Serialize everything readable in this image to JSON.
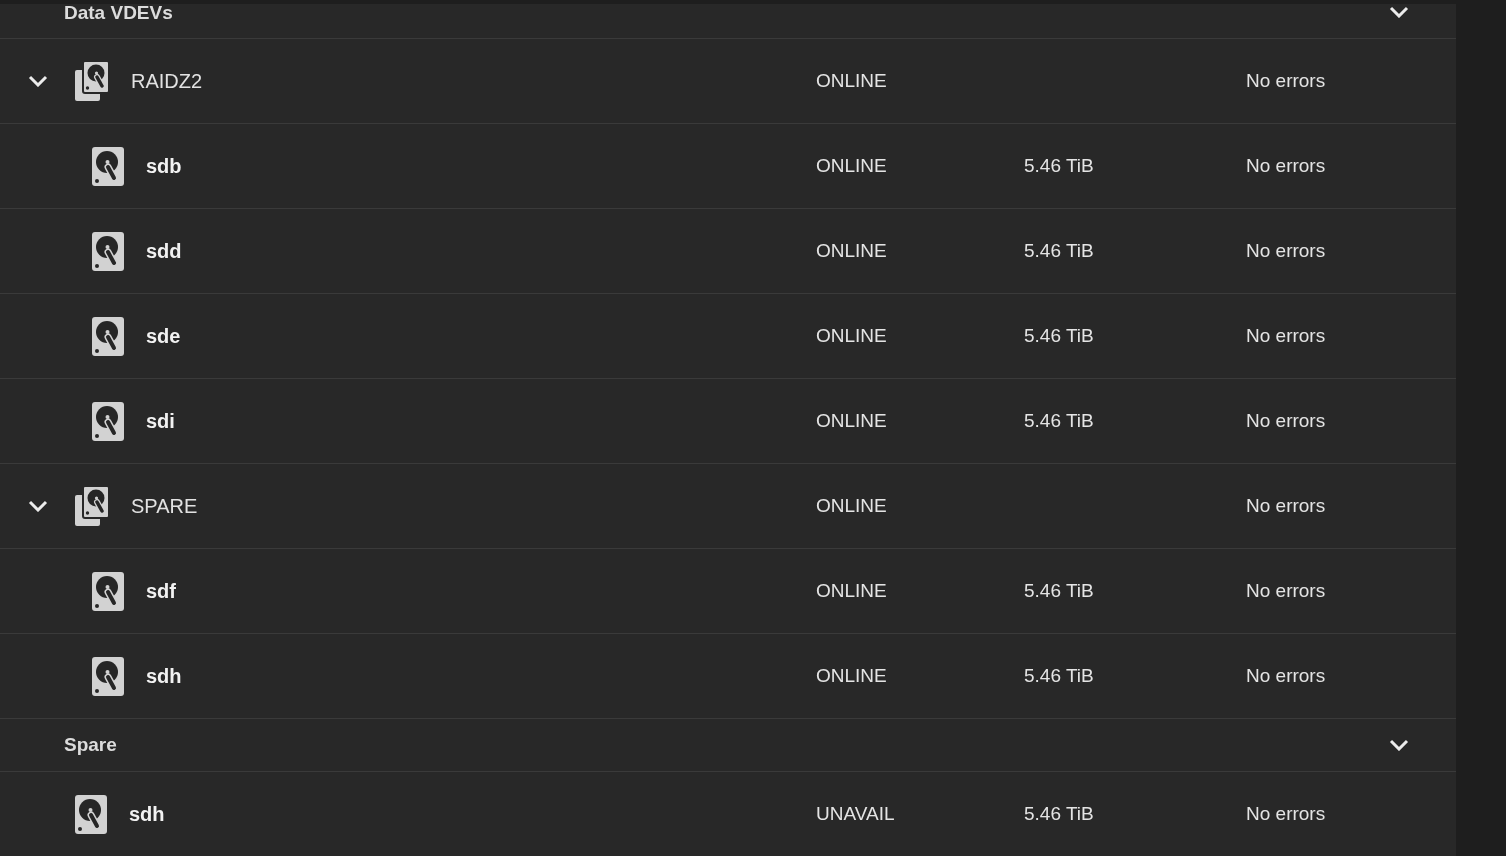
{
  "sections": [
    {
      "title": "Data VDEVs",
      "expanded": true,
      "items": [
        {
          "kind": "vdev",
          "name": "RAIDZ2",
          "expanded": true,
          "status": "ONLINE",
          "errors": "No errors",
          "children": [
            {
              "kind": "disk",
              "name": "sdb",
              "status": "ONLINE",
              "size": "5.46 TiB",
              "errors": "No errors"
            },
            {
              "kind": "disk",
              "name": "sdd",
              "status": "ONLINE",
              "size": "5.46 TiB",
              "errors": "No errors"
            },
            {
              "kind": "disk",
              "name": "sde",
              "status": "ONLINE",
              "size": "5.46 TiB",
              "errors": "No errors"
            },
            {
              "kind": "disk",
              "name": "sdi",
              "status": "ONLINE",
              "size": "5.46 TiB",
              "errors": "No errors"
            }
          ]
        },
        {
          "kind": "vdev",
          "name": "SPARE",
          "expanded": true,
          "status": "ONLINE",
          "errors": "No errors",
          "children": [
            {
              "kind": "disk",
              "name": "sdf",
              "status": "ONLINE",
              "size": "5.46 TiB",
              "errors": "No errors"
            },
            {
              "kind": "disk",
              "name": "sdh",
              "status": "ONLINE",
              "size": "5.46 TiB",
              "errors": "No errors"
            }
          ]
        }
      ]
    },
    {
      "title": "Spare",
      "expanded": true,
      "items": [
        {
          "kind": "disk",
          "name": "sdh",
          "status": "UNAVAIL",
          "size": "5.46 TiB",
          "errors": "No errors"
        }
      ]
    }
  ]
}
